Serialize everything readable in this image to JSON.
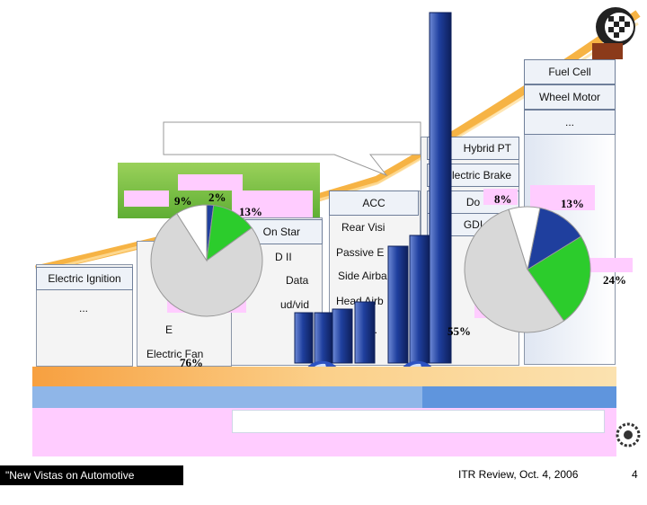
{
  "slide_number": "4",
  "footer": {
    "left": "\"New Vistas on Automotive Embedded Systems\", ASV",
    "center": "ITR Review, Oct. 4, 2006"
  },
  "stacks": {
    "right": [
      "Fuel Cell",
      "Wheel Motor",
      "..."
    ],
    "center_right": [
      "Hybrid PT",
      "Electric Brake",
      "Do",
      "GDI"
    ],
    "center": [
      "ACC",
      "Rear Visi",
      "Passive E",
      "Side Airba",
      "Head Airb",
      "..."
    ],
    "center_left": [
      "On Star",
      "D II",
      "Data",
      "ud/vid"
    ],
    "left_inner": [
      "E",
      "Electric Fan"
    ],
    "left": [
      "Electric Ignition",
      "..."
    ]
  },
  "pie_left": {
    "labels": [
      "9%",
      "2%",
      "13%",
      "76%"
    ],
    "values": [
      9,
      2,
      13,
      76
    ]
  },
  "pie_right": {
    "labels": [
      "8%",
      "13%",
      "24%",
      "55%"
    ],
    "values": [
      8,
      13,
      24,
      55
    ]
  },
  "colors": {
    "trend": "#f5a623",
    "green": "#7cc242",
    "blue": "#1f3f9e",
    "pink": "#ffccff",
    "footer_dark": "#000000"
  }
}
